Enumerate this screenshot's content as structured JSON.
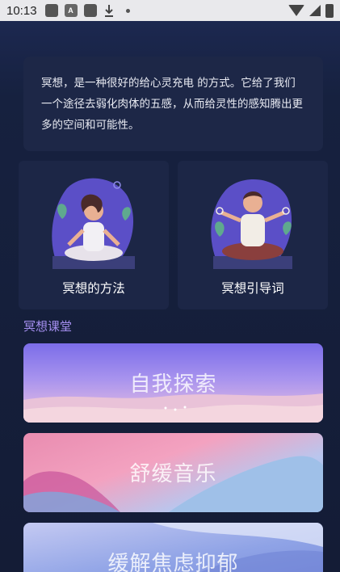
{
  "status_bar": {
    "time": "10:13"
  },
  "intro": {
    "text": "冥想，是一种很好的给心灵充电 的方式。它给了我们一个途径去弱化肉体的五感，从而给灵性的感知腾出更多的空间和可能性。"
  },
  "features": [
    {
      "label": "冥想的方法",
      "icon": "meditating-woman-illustration"
    },
    {
      "label": "冥想引导词",
      "icon": "meditating-man-illustration"
    }
  ],
  "section": {
    "title": "冥想课堂"
  },
  "courses": [
    {
      "title": "自我探索"
    },
    {
      "title": "舒缓音乐"
    },
    {
      "title": "缓解焦虑抑郁"
    }
  ],
  "colors": {
    "background": "#16213f",
    "card": "#1d2747",
    "section_title": "#a58ff0"
  }
}
